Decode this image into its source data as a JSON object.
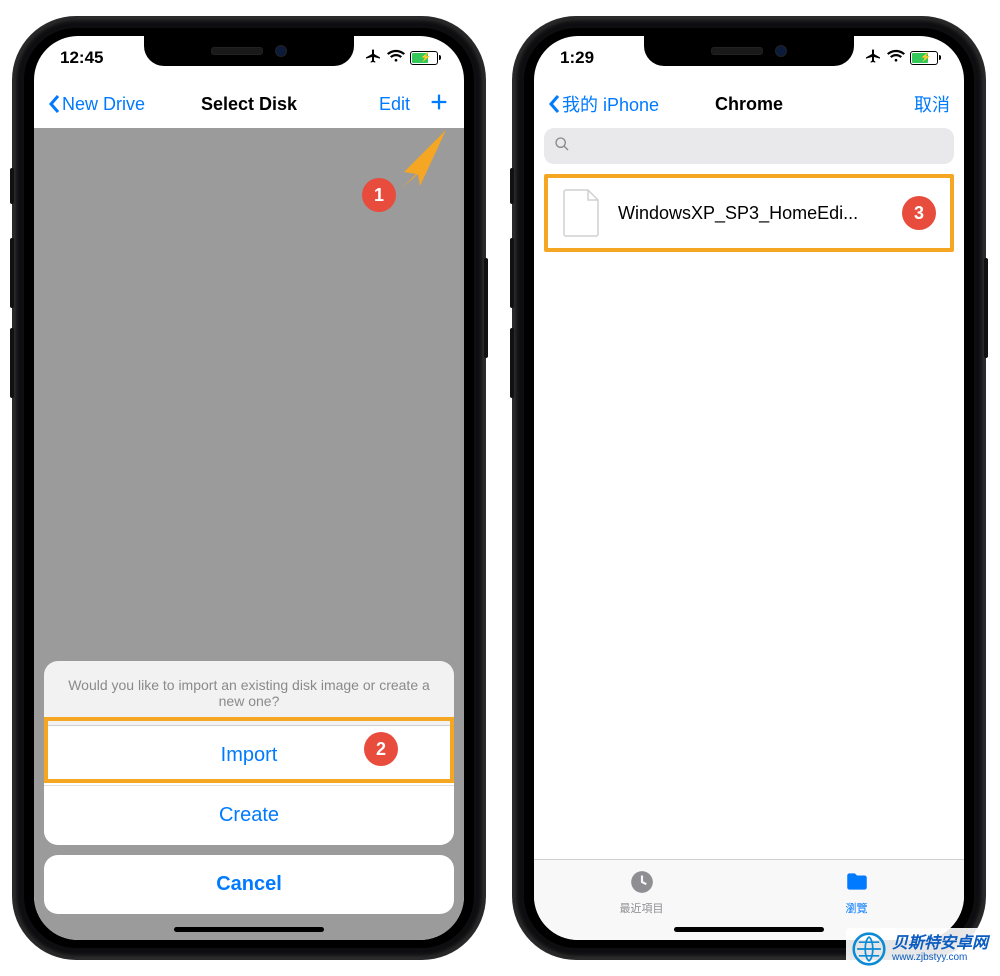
{
  "left": {
    "status_time": "12:45",
    "nav_back": "New Drive",
    "nav_title": "Select Disk",
    "nav_edit": "Edit",
    "sheet_message": "Would you like to import an existing disk image or create a new one?",
    "sheet_import": "Import",
    "sheet_create": "Create",
    "sheet_cancel": "Cancel",
    "badge1": "1",
    "badge2": "2"
  },
  "right": {
    "status_time": "1:29",
    "nav_back": "我的 iPhone",
    "nav_title": "Chrome",
    "nav_cancel": "取消",
    "file_name": "WindowsXP_SP3_HomeEdi...",
    "badge3": "3",
    "tab_recents": "最近項目",
    "tab_browse": "瀏覽"
  },
  "watermark": {
    "name": "贝斯特安卓网",
    "url": "www.zjbstyy.com"
  }
}
